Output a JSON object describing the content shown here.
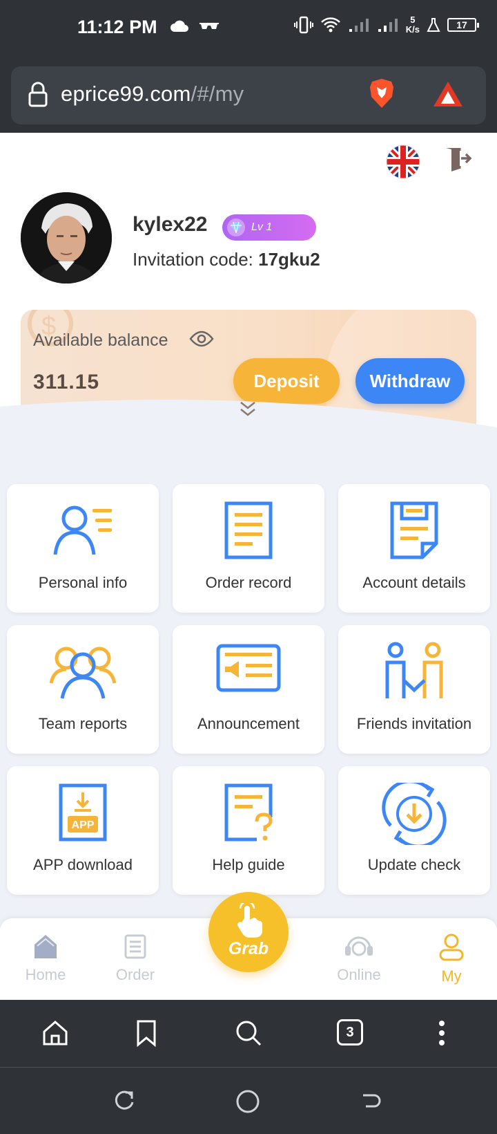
{
  "status_bar": {
    "time": "11:12 PM",
    "net_speed_value": "5",
    "net_speed_unit": "K/s",
    "battery": "17"
  },
  "browser": {
    "url_domain": "eprice99.com",
    "url_path": "/#/my",
    "tab_count": "3"
  },
  "profile": {
    "username": "kylex22",
    "level": "Lv 1",
    "invitation_label": "Invitation code: ",
    "invitation_code": "17gku2"
  },
  "balance": {
    "label": "Available balance",
    "value": "311.15",
    "deposit_label": "Deposit",
    "withdraw_label": "Withdraw"
  },
  "menu": [
    {
      "label": "Personal info",
      "icon": "personal-info-icon"
    },
    {
      "label": "Order record",
      "icon": "order-record-icon"
    },
    {
      "label": "Account details",
      "icon": "account-details-icon"
    },
    {
      "label": "Team reports",
      "icon": "team-reports-icon"
    },
    {
      "label": "Announcement",
      "icon": "announcement-icon"
    },
    {
      "label": "Friends invitation",
      "icon": "friends-invitation-icon"
    },
    {
      "label": "APP download",
      "icon": "app-download-icon"
    },
    {
      "label": "Help guide",
      "icon": "help-guide-icon"
    },
    {
      "label": "Update check",
      "icon": "update-check-icon"
    }
  ],
  "app_download_badge": "APP",
  "bottom_nav": {
    "home": "Home",
    "order": "Order",
    "grab": "Grab",
    "online": "Online",
    "my": "My",
    "active": "My"
  },
  "colors": {
    "blue": "#3d86f5",
    "orange": "#f6b539",
    "yellow": "#f5c02a",
    "purple": "#b066f3",
    "dark_bar": "#2f3338"
  }
}
